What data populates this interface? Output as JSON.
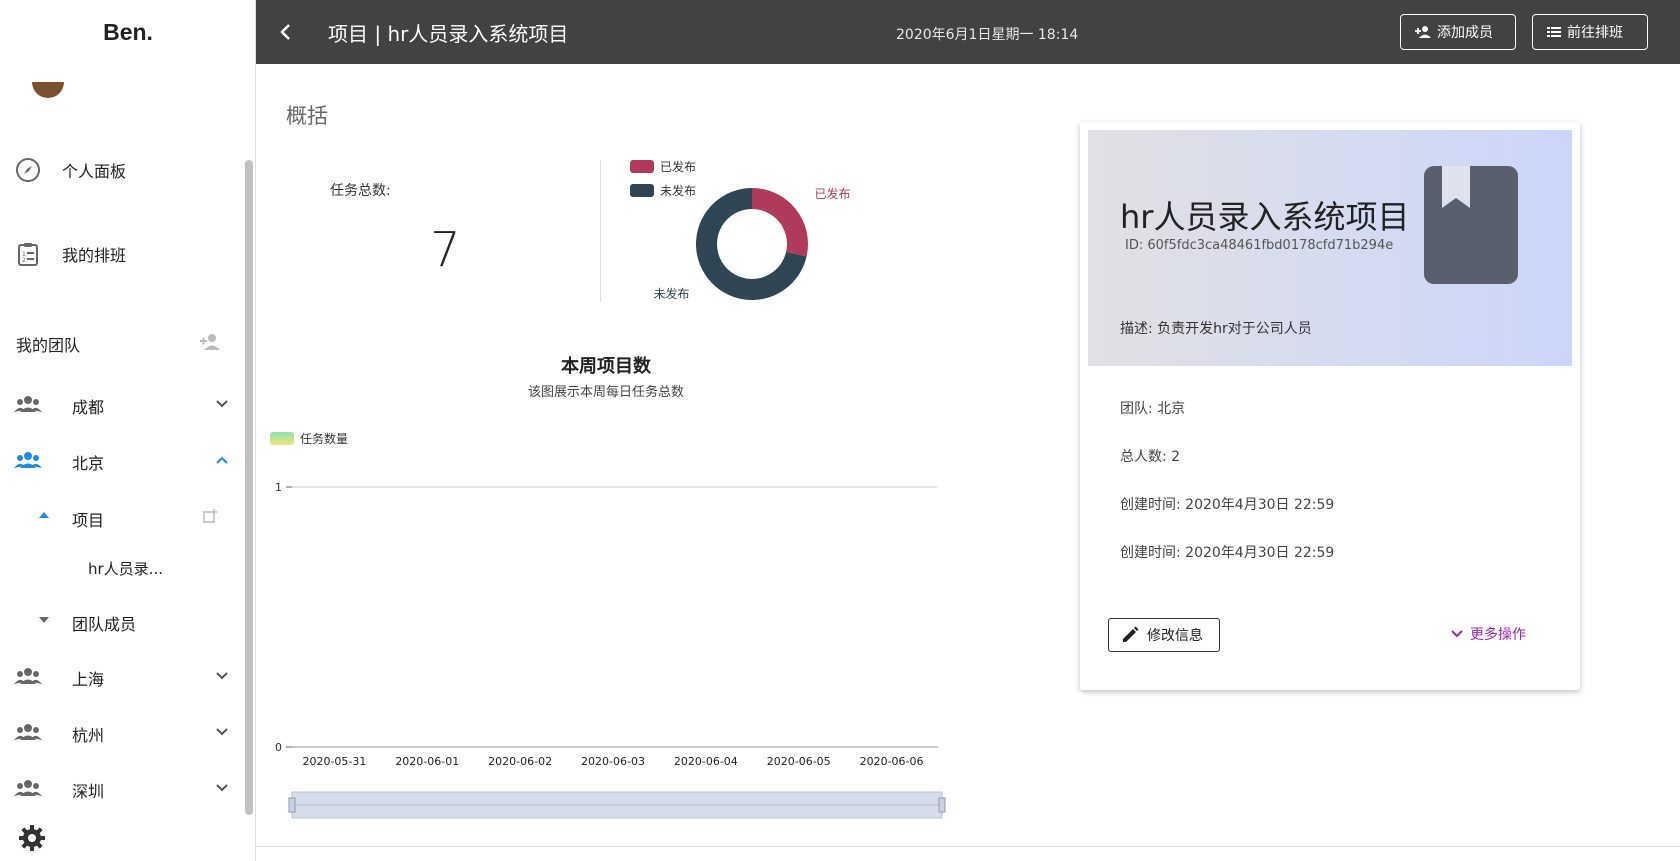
{
  "brand": "Ben.",
  "nav": {
    "dashboard": "个人面板",
    "schedule": "我的排班",
    "my_teams": "我的团队"
  },
  "teams": [
    {
      "name": "成都"
    },
    {
      "name": "北京"
    },
    {
      "name": "上海"
    },
    {
      "name": "杭州"
    },
    {
      "name": "深圳"
    }
  ],
  "beijing_children": {
    "projects": "项目",
    "project_item": "hr人员录...",
    "members": "团队成员"
  },
  "topbar": {
    "title": "项目 | hr人员录入系统项目",
    "datetime": "2020年6月1日星期一 18:14",
    "add_member": "添加成员",
    "go_schedule": "前往排班"
  },
  "main": {
    "section_title": "概括",
    "task_total_label": "任务总数:",
    "task_total_value": "7"
  },
  "project_card": {
    "name": "hr人员录入系统项目",
    "id": "ID: 60f5fdc3ca48461fbd0178cfd71b294e",
    "description": "描述: 负责开发hr对于公司人员",
    "team": "团队: 北京",
    "members": "总人数: 2",
    "created_1": "创建时间: 2020年4月30日 22:59",
    "created_2": "创建时间: 2020年4月30日 22:59",
    "edit_label": "修改信息",
    "more_label": "更多操作"
  },
  "colors": {
    "published": "#b03a5b",
    "unpublished": "#2f4554",
    "topbar": "#424242",
    "accent_blue": "#1e88e5",
    "accent_purple": "#9c27b0"
  },
  "chart_data": [
    {
      "type": "pie",
      "legend": [
        "已发布",
        "未发布"
      ],
      "slices": [
        {
          "label": "已发布",
          "value": 2
        },
        {
          "label": "未发布",
          "value": 5
        }
      ]
    },
    {
      "type": "bar",
      "title": "本周项目数",
      "subtitle": "该图展示本周每日任务总数",
      "legend": [
        "任务数量"
      ],
      "categories": [
        "2020-05-31",
        "2020-06-01",
        "2020-06-02",
        "2020-06-03",
        "2020-06-04",
        "2020-06-05",
        "2020-06-06"
      ],
      "values": [
        0,
        0,
        0,
        0,
        0,
        0,
        0
      ],
      "yticks": [
        "0",
        "1"
      ],
      "ylim": [
        0,
        1
      ]
    }
  ]
}
